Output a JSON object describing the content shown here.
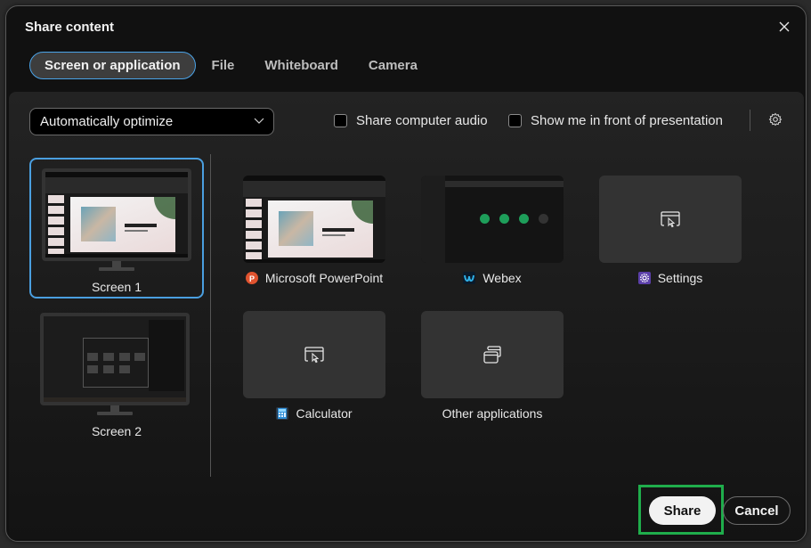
{
  "dialog": {
    "title": "Share content",
    "close_label": "Close"
  },
  "tabs": [
    {
      "label": "Screen or application",
      "active": true
    },
    {
      "label": "File",
      "active": false
    },
    {
      "label": "Whiteboard",
      "active": false
    },
    {
      "label": "Camera",
      "active": false
    }
  ],
  "options": {
    "optimize_dropdown": {
      "selected": "Automatically optimize"
    },
    "share_audio": {
      "label": "Share computer audio",
      "checked": false
    },
    "show_me": {
      "label": "Show me in front of presentation",
      "checked": false
    },
    "settings_icon": "gear-icon"
  },
  "screens": [
    {
      "label": "Screen 1",
      "selected": true
    },
    {
      "label": "Screen 2",
      "selected": false
    }
  ],
  "applications": [
    {
      "name": "Microsoft PowerPoint",
      "icon": "powerpoint-icon",
      "icon_color": "#e0532f",
      "preview": "screenshot"
    },
    {
      "name": "Webex",
      "icon": "webex-icon",
      "icon_color": "#1f7ad6",
      "preview": "screenshot"
    },
    {
      "name": "Settings",
      "icon": "settings-app-icon",
      "icon_color": "#5b3fa8",
      "preview": "window-cursor-icon"
    },
    {
      "name": "Calculator",
      "icon": "calculator-icon",
      "icon_color": "#2f8fd8",
      "preview": "window-cursor-icon"
    },
    {
      "name": "Other applications",
      "icon": "",
      "icon_color": "",
      "preview": "stacked-windows-icon"
    }
  ],
  "footer": {
    "share_label": "Share",
    "cancel_label": "Cancel",
    "highlight_color": "#1fad4b"
  },
  "colors": {
    "accent": "#4a9fe0",
    "dialog_bg": "#111111",
    "tile_bg": "#333333"
  }
}
